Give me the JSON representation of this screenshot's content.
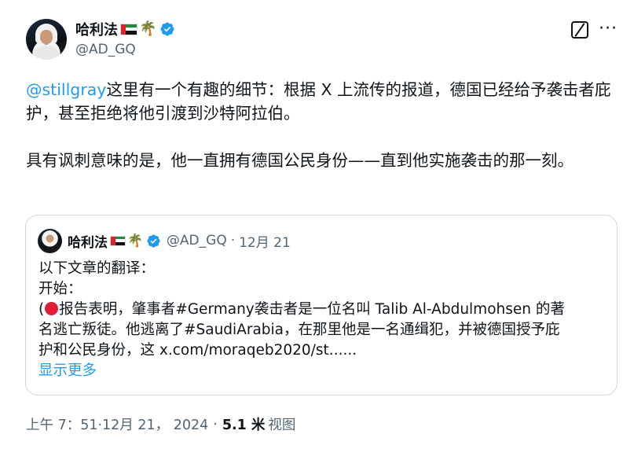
{
  "author": {
    "display_name": "哈利法",
    "palm": "🌴",
    "handle": "@AD_GQ"
  },
  "tweet": {
    "mention": "@stillgray",
    "paragraph1_rest": "这里有一个有趣的细节：根据 X 上流传的报道，德国已经给予袭击者庇护，甚至拒绝将他引渡到沙特阿拉伯。",
    "paragraph2": "具有讽刺意味的是，他一直拥有德国公民身份——直到他实施袭击的那一刻。"
  },
  "quote": {
    "display_name": "哈利法",
    "palm": "🌴",
    "handle": "@AD_GQ",
    "dot": "·",
    "date": "12月 21",
    "line1": "以下文章的翻译：",
    "line2": "开始：",
    "line3_prefix": "(",
    "line3_rest": "报告表明，肇事者#Germany袭击者是一位名叫 Talib Al-Abdulmohsen 的著",
    "line4": "名逃亡叛徒。他逃离了#SaudiArabia，在那里他是一名通缉犯，并被德国授予庇",
    "line5": "护和公民身份，这 x.com/moraqeb2020/st......",
    "show_more": "显示更多"
  },
  "meta": {
    "time": "上午 7：51",
    "date": "·12月 21， 2024",
    "sep": "·",
    "views_count": "5.1 米",
    "views_label": "视图"
  },
  "colors": {
    "link": "#1d9bf0",
    "verified": "#1d9bf0",
    "text": "#0f1419",
    "secondary": "#536471",
    "border": "#cfd9de"
  },
  "icons": [
    "verified-badge-icon",
    "grok-icon",
    "more-icon",
    "uae-flag-icon",
    "palm-tree-icon",
    "red-circle-icon"
  ]
}
